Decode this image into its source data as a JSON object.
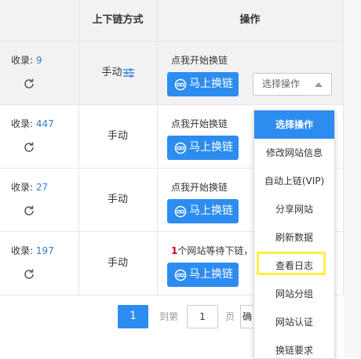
{
  "header": {
    "col_mode": "上下链方式",
    "col_ops": "操作"
  },
  "rows": [
    {
      "shoulu_label": "收录:",
      "shoulu_value": "9",
      "mode": "手动",
      "hint_count": "",
      "hint": "点我开始换链",
      "button": "马上换链",
      "select": "选择操作"
    },
    {
      "shoulu_label": "收录:",
      "shoulu_value": "447",
      "mode": "手动",
      "hint_count": "",
      "hint": "点我开始换链",
      "button": "马上换链"
    },
    {
      "shoulu_label": "收录:",
      "shoulu_value": "27",
      "mode": "手动",
      "hint_count": "",
      "hint": "点我开始换链",
      "button": "马上换链"
    },
    {
      "shoulu_label": "收录:",
      "shoulu_value": "197",
      "mode": "手动",
      "hint_count": "1",
      "hint": "个网站等待下链，",
      "button": "马上换链"
    }
  ],
  "dropdown": {
    "items": [
      "选择操作",
      "修改网站信息",
      "自动上链(VIP)",
      "分享网站",
      "刷新数据",
      "查看日志",
      "网站分组",
      "网站认证",
      "换链要求"
    ],
    "selected": "选择操作",
    "highlighted": "查看日志"
  },
  "pager": {
    "current": "1",
    "goto_label": "到第",
    "goto_value": "1",
    "page_label": "页",
    "confirm_partial": "确"
  },
  "colors": {
    "primary": "#2d8cf0",
    "link": "#3a7ac2",
    "highlight_box": "#fff040",
    "warn": "#d0021b"
  },
  "icons": [
    "refresh-icon",
    "sliders-icon",
    "chain-icon",
    "caret-up-icon"
  ]
}
